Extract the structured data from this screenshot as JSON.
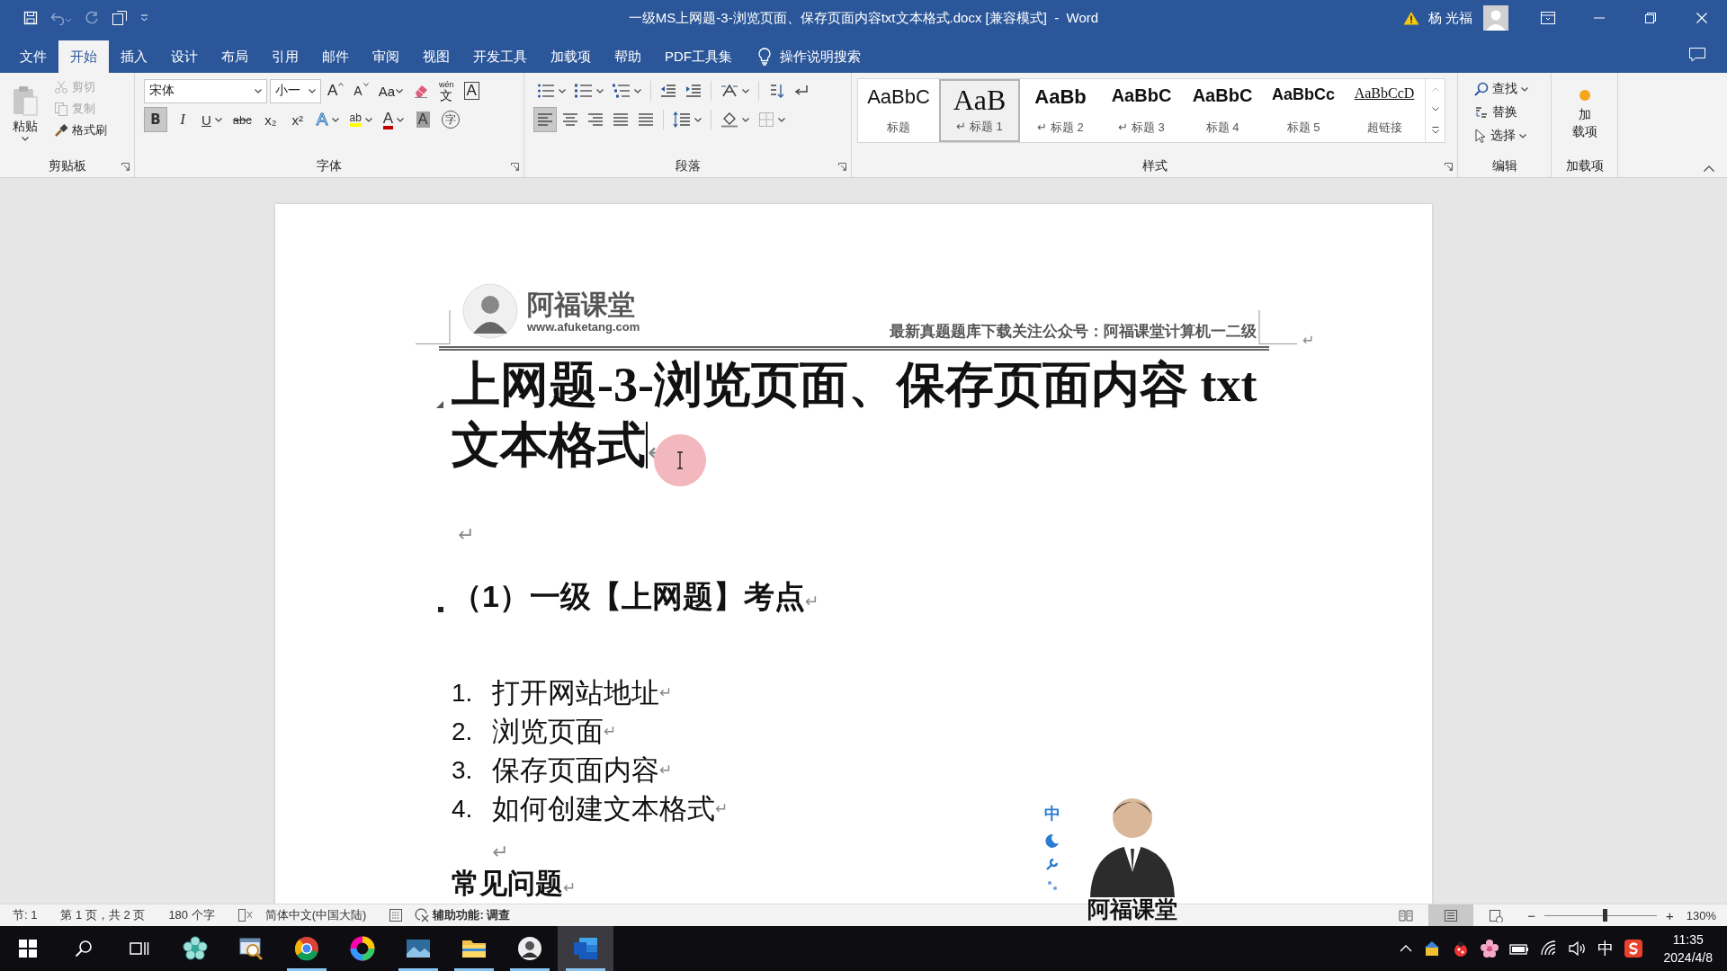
{
  "window": {
    "title": "一级MS上网题-3-浏览页面、保存页面内容txt文本格式.docx [兼容模式]  -  Word",
    "user_name": "杨 光福"
  },
  "ribbon_tabs": [
    {
      "label": "文件",
      "selected": false
    },
    {
      "label": "开始",
      "selected": true
    },
    {
      "label": "插入",
      "selected": false
    },
    {
      "label": "设计",
      "selected": false
    },
    {
      "label": "布局",
      "selected": false
    },
    {
      "label": "引用",
      "selected": false
    },
    {
      "label": "邮件",
      "selected": false
    },
    {
      "label": "审阅",
      "selected": false
    },
    {
      "label": "视图",
      "selected": false
    },
    {
      "label": "开发工具",
      "selected": false
    },
    {
      "label": "加载项",
      "selected": false
    },
    {
      "label": "帮助",
      "selected": false
    },
    {
      "label": "PDF工具集",
      "selected": false
    }
  ],
  "tell_me": {
    "label": "操作说明搜索"
  },
  "clipboard": {
    "paste": "粘贴",
    "cut": {
      "label": "剪切",
      "disabled": true
    },
    "copy": {
      "label": "复制",
      "disabled": true
    },
    "format_painter": {
      "label": "格式刷",
      "disabled": false
    },
    "group_label": "剪贴板"
  },
  "font": {
    "name": "宋体",
    "size": "小一",
    "group_label": "字体",
    "tools": [
      {
        "kind": "grow",
        "label": "A"
      },
      {
        "kind": "shrink",
        "label": "A"
      },
      {
        "kind": "case",
        "label": "Aa"
      },
      {
        "kind": "clear"
      },
      {
        "kind": "phonetic",
        "label": "文",
        "ruby": "wén"
      },
      {
        "kind": "border",
        "label": "A"
      }
    ],
    "formats": [
      {
        "kind": "bold",
        "label": "B",
        "selected": true
      },
      {
        "kind": "italic",
        "label": "I",
        "selected": false
      },
      {
        "kind": "underline",
        "label": "U",
        "selected": false
      },
      {
        "kind": "strike",
        "label": "abc",
        "selected": false
      },
      {
        "kind": "subscript",
        "label": "x₂",
        "selected": false
      },
      {
        "kind": "superscript",
        "label": "x²",
        "selected": false
      },
      {
        "kind": "effects",
        "label": "A",
        "selected": false
      },
      {
        "kind": "highlight",
        "label": "ab",
        "selected": false,
        "color": "#ffff00"
      },
      {
        "kind": "font_color",
        "label": "A",
        "selected": false,
        "color": "#c00000"
      },
      {
        "kind": "shading",
        "label": "A",
        "selected": false
      },
      {
        "kind": "enclose",
        "label": "字",
        "selected": false
      }
    ]
  },
  "paragraph": {
    "alignments": [
      {
        "kind": "left",
        "selected": true
      },
      {
        "kind": "center",
        "selected": false
      },
      {
        "kind": "right",
        "selected": false
      },
      {
        "kind": "justify",
        "selected": false
      },
      {
        "kind": "distributed",
        "selected": false
      }
    ],
    "group_label": "段落"
  },
  "styles": {
    "group_label": "样式",
    "items": [
      {
        "kind": "title",
        "preview": "AaBbC",
        "label": "标题",
        "selected": false
      },
      {
        "kind": "heading1",
        "preview": "AaB",
        "label": "↵ 标题 1",
        "selected": true
      },
      {
        "kind": "heading2",
        "preview": "AaBb",
        "label": "↵ 标题 2",
        "selected": false
      },
      {
        "kind": "heading3",
        "preview": "AaBbC",
        "label": "↵ 标题 3",
        "selected": false
      },
      {
        "kind": "heading4",
        "preview": "AaBbC",
        "label": "标题 4",
        "selected": false
      },
      {
        "kind": "heading5",
        "preview": "AaBbCc",
        "label": "标题 5",
        "selected": false
      },
      {
        "kind": "hyperlink",
        "preview": "AaBbCcD",
        "label": "超链接",
        "selected": false
      }
    ]
  },
  "editing": {
    "find": "查找",
    "replace": "替换",
    "select": "选择",
    "group_label": "编辑"
  },
  "addins": {
    "button_lines": [
      "加",
      "载项"
    ],
    "group_label": "加载项"
  },
  "document": {
    "header": {
      "brand": "阿福课堂",
      "url": "www.afuketang.com",
      "text": "最新真题题库下载关注公众号：阿福课堂计算机一二级",
      "mark": "↵"
    },
    "paragraphs": [
      {
        "kind": "title",
        "text": "上网题-3-浏览页面、保存页面内容 txt 文本格式",
        "mark": "↵"
      },
      {
        "kind": "empty",
        "mark": "↵"
      },
      {
        "kind": "heading",
        "text": "（1）一级【上网题】考点",
        "mark": "↵"
      },
      {
        "kind": "list_item",
        "number": "1.",
        "text": "打开网站地址",
        "mark": "↵"
      },
      {
        "kind": "list_item",
        "number": "2.",
        "text": "浏览页面",
        "mark": "↵"
      },
      {
        "kind": "list_item",
        "number": "3.",
        "text": "保存页面内容",
        "mark": "↵"
      },
      {
        "kind": "list_item",
        "number": "4.",
        "text": "如何创建文本格式",
        "mark": "↵"
      },
      {
        "kind": "list_empty",
        "mark": "↵"
      },
      {
        "kind": "subheading",
        "text": "常见问题",
        "mark": "↵"
      }
    ]
  },
  "ime_toolbar": {
    "label": "中"
  },
  "presenter_overlay": {
    "caption": "阿福课堂"
  },
  "status_bar": {
    "section": "节: 1",
    "page": "第 1 页，共 2 页",
    "words": "180 个字",
    "language": "简体中文(中国大陆)",
    "accessibility": "辅助功能: 调查",
    "views": [
      {
        "kind": "read",
        "selected": false
      },
      {
        "kind": "print",
        "selected": true
      },
      {
        "kind": "web",
        "selected": false
      }
    ],
    "zoom": {
      "minus": "−",
      "plus": "+",
      "level": 0.54,
      "value": "130%"
    }
  },
  "taskbar": {
    "apps": [
      {
        "kind": "flower",
        "running": false,
        "active": false
      },
      {
        "kind": "magnifier",
        "running": false,
        "active": false
      },
      {
        "kind": "tricolor",
        "running": true,
        "active": false
      },
      {
        "kind": "rainbow",
        "running": false,
        "active": false
      },
      {
        "kind": "photos",
        "running": true,
        "active": false
      },
      {
        "kind": "folder",
        "running": true,
        "active": false
      },
      {
        "kind": "avatar",
        "running": true,
        "active": false
      },
      {
        "kind": "word",
        "running": true,
        "active": true
      }
    ],
    "ime": "中",
    "time": "11:35",
    "date": "2024/4/8"
  }
}
